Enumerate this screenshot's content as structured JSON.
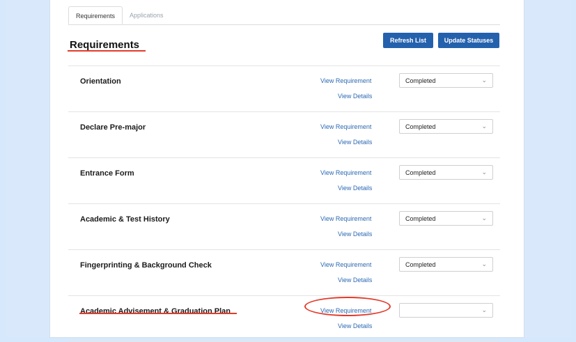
{
  "tabs": [
    {
      "label": "Requirements",
      "active": true
    },
    {
      "label": "Applications",
      "active": false
    }
  ],
  "page_title": "Requirements",
  "buttons": {
    "refresh": "Refresh List",
    "update": "Update Statuses"
  },
  "colors": {
    "accent": "#2461ad",
    "link": "#2b68b3",
    "annotation": "#e23b2a"
  },
  "rows": [
    {
      "title": "Orientation",
      "view_requirement": "View Requirement",
      "view_details": "View Details",
      "status": "Completed"
    },
    {
      "title": "Declare Pre-major",
      "view_requirement": "View Requirement",
      "view_details": "View Details",
      "status": "Completed"
    },
    {
      "title": "Entrance Form",
      "view_requirement": "View Requirement",
      "view_details": "View Details",
      "status": "Completed"
    },
    {
      "title": "Academic & Test History",
      "view_requirement": "View Requirement",
      "view_details": "View Details",
      "status": "Completed"
    },
    {
      "title": "Fingerprinting & Background Check",
      "view_requirement": "View Requirement",
      "view_details": "View Details",
      "status": "Completed"
    },
    {
      "title": "Academic Advisement & Graduation Plan",
      "view_requirement": "View Requirement",
      "view_details": "View Details",
      "status": ""
    }
  ]
}
